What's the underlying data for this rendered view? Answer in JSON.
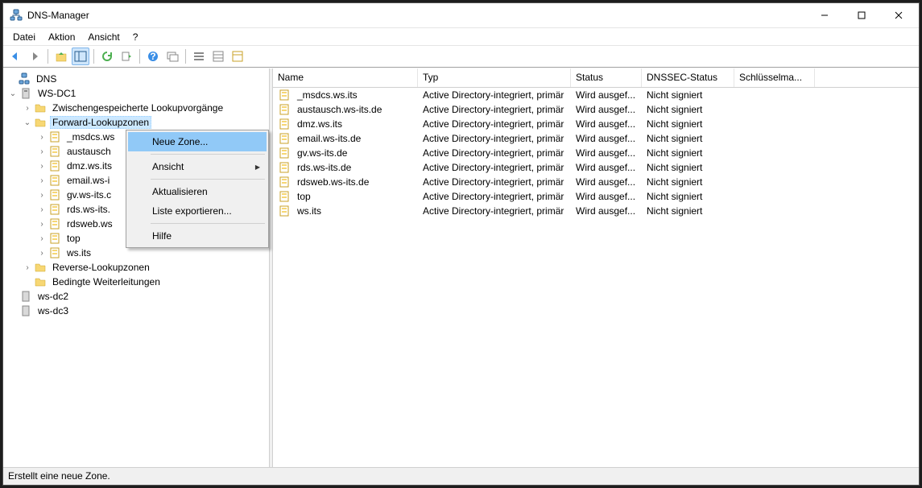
{
  "window": {
    "title": "DNS-Manager"
  },
  "menubar": [
    "Datei",
    "Aktion",
    "Ansicht",
    "?"
  ],
  "toolbar_icons": [
    "back",
    "forward",
    "up",
    "show-hide-tree",
    "properties",
    "refresh",
    "export",
    "help",
    "new-window",
    "list-view",
    "detail-view",
    "filter"
  ],
  "tree": {
    "root": "DNS",
    "server": "WS-DC1",
    "nodes": {
      "cache": "Zwischengespeicherte Lookupvorgänge",
      "fwd": "Forward-Lookupzonen",
      "rev": "Reverse-Lookupzonen",
      "cond": "Bedingte Weiterleitungen"
    },
    "fwd_zones": [
      "_msdcs.ws",
      "austausch",
      "dmz.ws.its",
      "email.ws-i",
      "gv.ws-its.c",
      "rds.ws-its.",
      "rdsweb.ws",
      "top",
      "ws.its"
    ],
    "other_servers": [
      "ws-dc2",
      "ws-dc3"
    ]
  },
  "columns": {
    "name": "Name",
    "typ": "Typ",
    "status": "Status",
    "dnssec": "DNSSEC-Status",
    "key": "Schlüsselma..."
  },
  "rows": [
    {
      "name": "_msdcs.ws.its",
      "typ": "Active Directory-integriert, primär",
      "status": "Wird ausgef...",
      "dnssec": "Nicht signiert"
    },
    {
      "name": "austausch.ws-its.de",
      "typ": "Active Directory-integriert, primär",
      "status": "Wird ausgef...",
      "dnssec": "Nicht signiert"
    },
    {
      "name": "dmz.ws.its",
      "typ": "Active Directory-integriert, primär",
      "status": "Wird ausgef...",
      "dnssec": "Nicht signiert"
    },
    {
      "name": "email.ws-its.de",
      "typ": "Active Directory-integriert, primär",
      "status": "Wird ausgef...",
      "dnssec": "Nicht signiert"
    },
    {
      "name": "gv.ws-its.de",
      "typ": "Active Directory-integriert, primär",
      "status": "Wird ausgef...",
      "dnssec": "Nicht signiert"
    },
    {
      "name": "rds.ws-its.de",
      "typ": "Active Directory-integriert, primär",
      "status": "Wird ausgef...",
      "dnssec": "Nicht signiert"
    },
    {
      "name": "rdsweb.ws-its.de",
      "typ": "Active Directory-integriert, primär",
      "status": "Wird ausgef...",
      "dnssec": "Nicht signiert"
    },
    {
      "name": "top",
      "typ": "Active Directory-integriert, primär",
      "status": "Wird ausgef...",
      "dnssec": "Nicht signiert"
    },
    {
      "name": "ws.its",
      "typ": "Active Directory-integriert, primär",
      "status": "Wird ausgef...",
      "dnssec": "Nicht signiert"
    }
  ],
  "context_menu": {
    "items": [
      {
        "label": "Neue Zone...",
        "highlight": true
      },
      {
        "sep": true
      },
      {
        "label": "Ansicht",
        "sub": true
      },
      {
        "sep": true
      },
      {
        "label": "Aktualisieren"
      },
      {
        "label": "Liste exportieren..."
      },
      {
        "sep": true
      },
      {
        "label": "Hilfe"
      }
    ]
  },
  "statusbar": "Erstellt eine neue Zone."
}
